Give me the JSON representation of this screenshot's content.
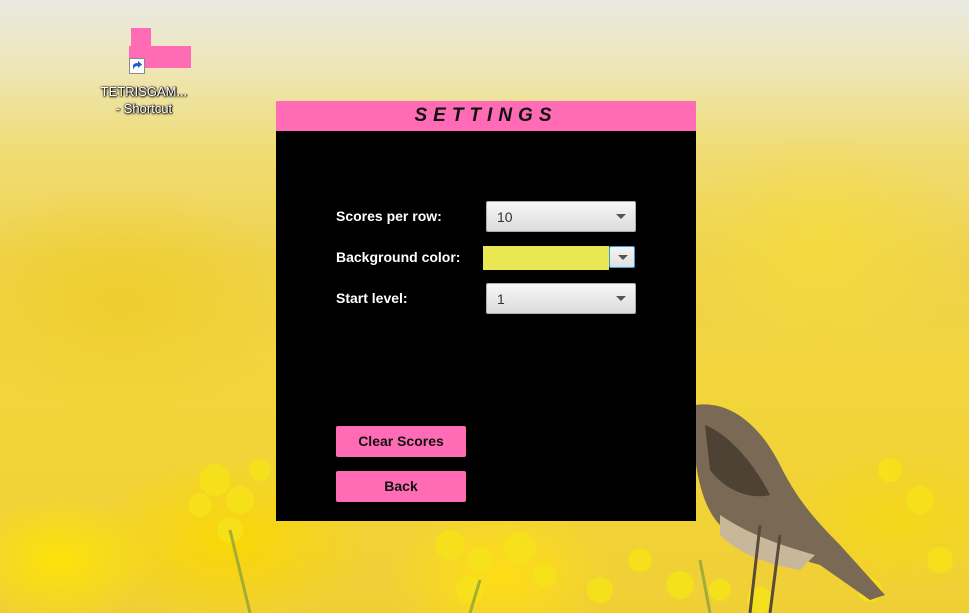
{
  "desktop": {
    "shortcut": {
      "icon": "tetris-block-icon",
      "overlay_icon": "shortcut-arrow-icon",
      "label_line1": "TETRISGAM...",
      "label_line2": "- Shortcut",
      "color": "#ff6bb5"
    },
    "wallpaper": "yellow-flowers-bird"
  },
  "window": {
    "title": "SETTINGS",
    "accent_color": "#ff6bb5",
    "background_color": "#000000",
    "fields": {
      "scores_per_row": {
        "label": "Scores per row:",
        "value": "10"
      },
      "background_color": {
        "label": "Background color:",
        "value_color": "#e9e752"
      },
      "start_level": {
        "label": "Start level:",
        "value": "1"
      }
    },
    "buttons": {
      "clear_scores": "Clear Scores",
      "back": "Back"
    }
  }
}
